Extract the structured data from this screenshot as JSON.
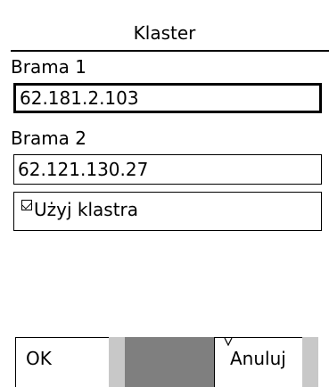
{
  "dialog": {
    "title": "Klaster"
  },
  "gateway1": {
    "label": "Brama 1",
    "value": "62.181.2.103"
  },
  "gateway2": {
    "label": "Brama 2",
    "value": "62.121.130.27"
  },
  "use_cluster": {
    "label": "Użyj klastra",
    "checked": true
  },
  "softkeys": {
    "left_label": "OK",
    "right_label": "Anuluj"
  },
  "icons": {
    "checkbox": "check-icon",
    "menu_indicator": "chevron-down-icon"
  },
  "colors": {
    "background": "#ffffff",
    "text": "#000000",
    "softbar_gap_light": "#c8c8c8",
    "softbar_gap_dark": "#7f7f7f"
  }
}
